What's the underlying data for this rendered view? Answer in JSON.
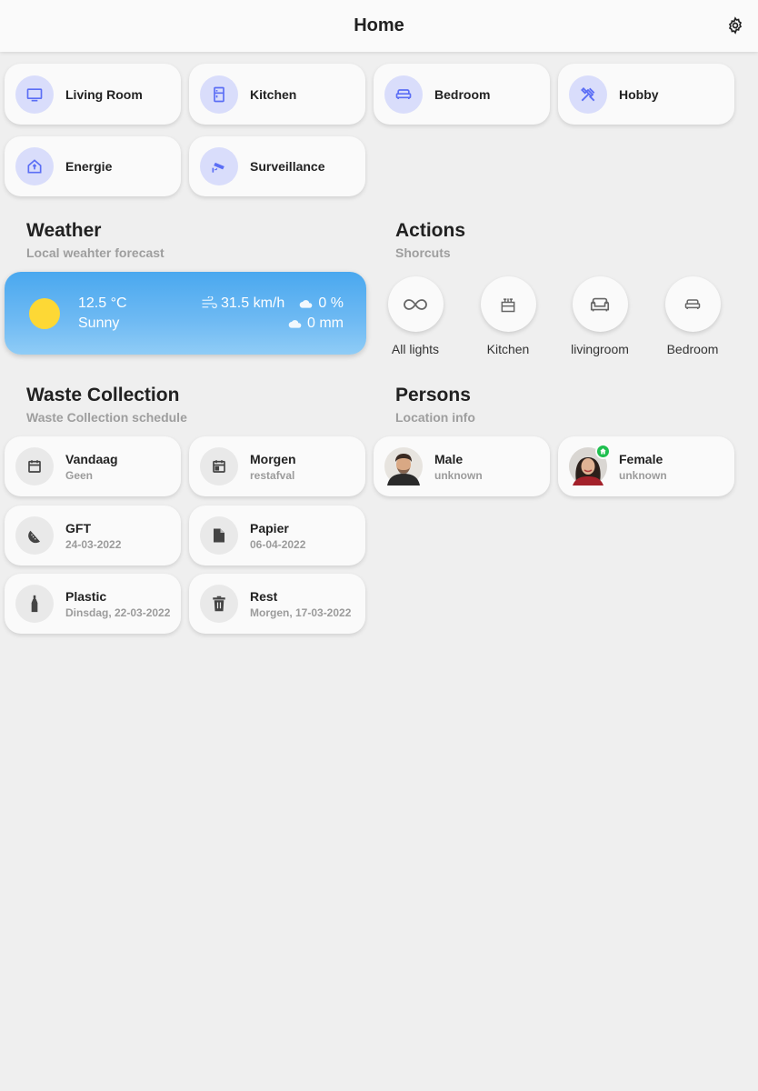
{
  "header": {
    "title": "Home",
    "settings_icon": "gear-icon"
  },
  "rooms": [
    {
      "label": "Living Room",
      "icon": "tv-icon"
    },
    {
      "label": "Kitchen",
      "icon": "fridge-icon"
    },
    {
      "label": "Bedroom",
      "icon": "bed-icon"
    },
    {
      "label": "Hobby",
      "icon": "tools-icon"
    },
    {
      "label": "Energie",
      "icon": "home-energy-icon"
    },
    {
      "label": "Surveillance",
      "icon": "cctv-icon"
    }
  ],
  "weather_section": {
    "title": "Weather",
    "subtitle": "Local weahter forecast"
  },
  "weather": {
    "temperature": "12.5 °C",
    "condition": "Sunny",
    "wind": "31.5 km/h",
    "humidity": "0 %",
    "precipitation": "0 mm"
  },
  "actions_section": {
    "title": "Actions",
    "subtitle": "Shorcuts"
  },
  "shortcuts": [
    {
      "label": "All lights",
      "icon": "infinity-icon"
    },
    {
      "label": "Kitchen",
      "icon": "stove-icon"
    },
    {
      "label": "livingroom",
      "icon": "sofa-icon"
    },
    {
      "label": "Bedroom",
      "icon": "bed-icon"
    }
  ],
  "waste_section": {
    "title": "Waste Collection",
    "subtitle": "Waste Collection schedule"
  },
  "waste": [
    {
      "label": "Vandaag",
      "value": "Geen",
      "icon": "calendar-icon"
    },
    {
      "label": "Morgen",
      "value": "restafval",
      "icon": "calendar-today-icon"
    },
    {
      "label": "GFT",
      "value": "24-03-2022",
      "icon": "fruit-watermelon-icon"
    },
    {
      "label": "Papier",
      "value": "06-04-2022",
      "icon": "file-icon"
    },
    {
      "label": "Plastic",
      "value": "Dinsdag, 22-03-2022",
      "icon": "bottle-icon"
    },
    {
      "label": "Rest",
      "value": "Morgen, 17-03-2022",
      "icon": "trash-can-icon"
    }
  ],
  "persons_section": {
    "title": "Persons",
    "subtitle": "Location info"
  },
  "persons": [
    {
      "name": "Male",
      "state": "unknown"
    },
    {
      "name": "Female",
      "state": "unknown"
    }
  ],
  "colors": {
    "accent": "#5b6ef5",
    "room_icon_bg": "#d9ddfb",
    "weather_top": "#4aa8ef",
    "weather_bottom": "#8fccf6",
    "home_badge": "#1fbf4f"
  }
}
